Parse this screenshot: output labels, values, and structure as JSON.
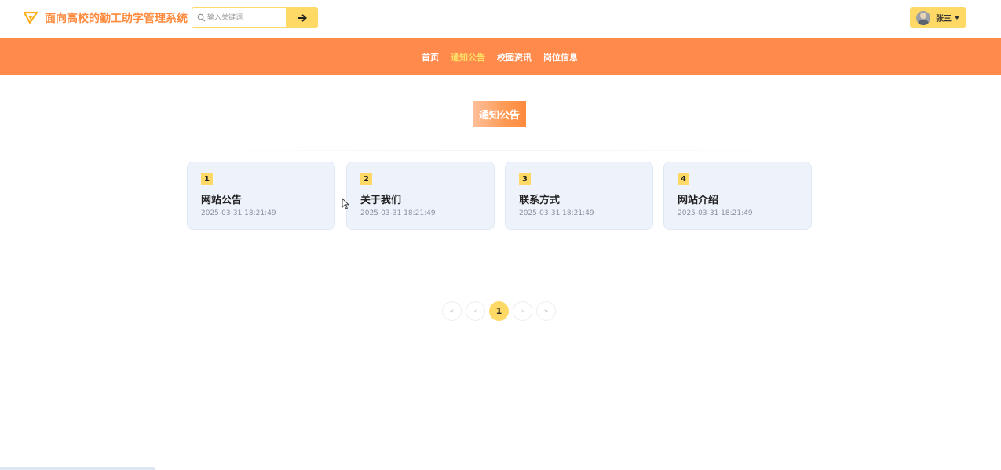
{
  "header": {
    "site_title": "面向高校的勤工助学管理系统",
    "search": {
      "placeholder": "输入关键词",
      "value": ""
    },
    "search_button_icon": "arrow-right-icon",
    "user": {
      "name": "张三",
      "avatar": "avatar-icon"
    }
  },
  "nav": {
    "items": [
      {
        "label": "首页",
        "active": false
      },
      {
        "label": "通知公告",
        "active": true
      },
      {
        "label": "校园资讯",
        "active": false
      },
      {
        "label": "岗位信息",
        "active": false
      }
    ]
  },
  "section": {
    "title": "通知公告"
  },
  "notices": [
    {
      "num": "1",
      "title": "网站公告",
      "date": "2025-03-31 18:21:49"
    },
    {
      "num": "2",
      "title": "关于我们",
      "date": "2025-03-31 18:21:49"
    },
    {
      "num": "3",
      "title": "联系方式",
      "date": "2025-03-31 18:21:49"
    },
    {
      "num": "4",
      "title": "网站介绍",
      "date": "2025-03-31 18:21:49"
    }
  ],
  "pagination": {
    "first": "«",
    "prev": "‹",
    "current": "1",
    "next": "›",
    "last": "»"
  },
  "colors": {
    "accent": "#ff8a4c",
    "highlight": "#ffd966",
    "card_bg": "#eef3fb",
    "title_text": "#ff8a3d"
  }
}
